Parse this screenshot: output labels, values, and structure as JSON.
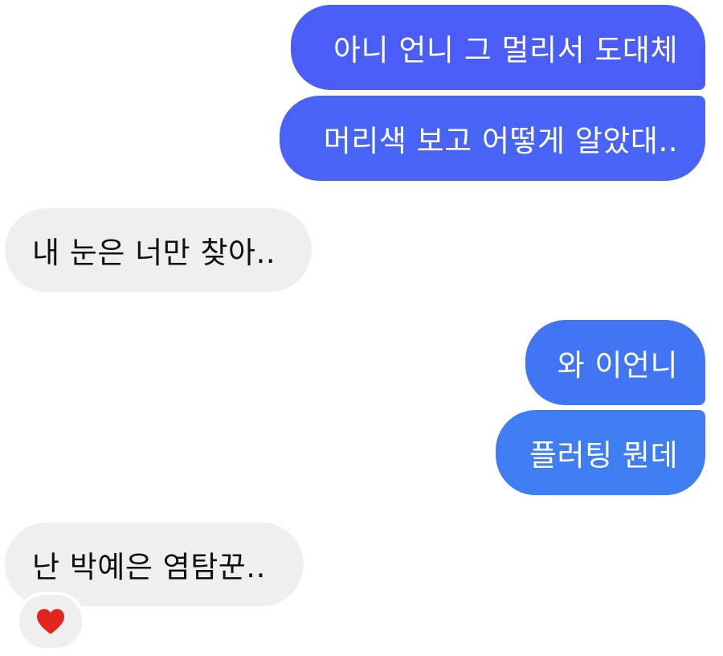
{
  "messages": [
    {
      "direction": "sent",
      "text": "아니 언니 그 멀리서 도대체"
    },
    {
      "direction": "sent",
      "text": "머리색 보고 어떻게 알았대.."
    },
    {
      "direction": "received",
      "text": "내 눈은 너만 찾아.."
    },
    {
      "direction": "sent",
      "text": "와 이언니"
    },
    {
      "direction": "sent",
      "text": "플러팅 뭔데"
    },
    {
      "direction": "received",
      "text": "난 박예은 염탐꾼.."
    }
  ],
  "reaction": {
    "icon": "heart-icon",
    "color": "#e2251f"
  },
  "colors": {
    "sent_top": "#4a5ef7",
    "sent_bottom": "#3f7df3",
    "received": "#efefef"
  }
}
